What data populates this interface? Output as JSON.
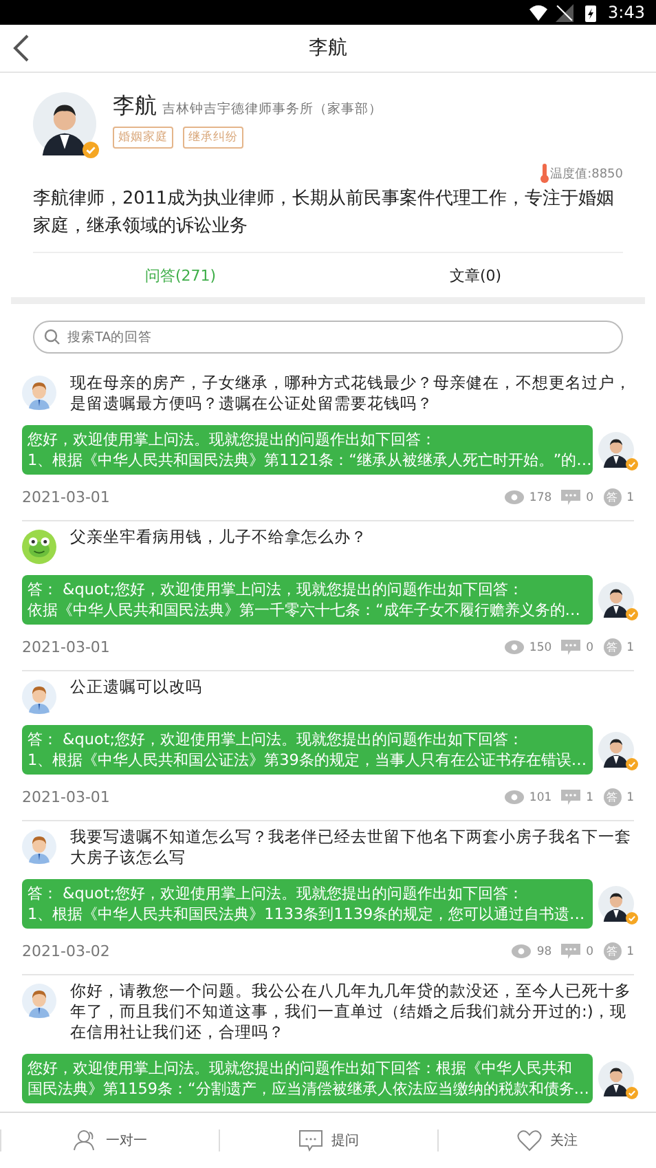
{
  "status_bar": {
    "time": "3:43"
  },
  "header": {
    "title": "李航"
  },
  "profile": {
    "name": "李航",
    "firm": "吉林钟吉宇德律师事务所（家事部）",
    "tags": [
      "婚姻家庭",
      "继承纠纷"
    ],
    "temperature": "温度值:8850",
    "bio": "李航律师，2011成为执业律师，长期从前民事案件代理工作，专注于婚姻家庭，继承领域的诉讼业务"
  },
  "tabs": [
    {
      "label": "问答(271)",
      "selected": true
    },
    {
      "label": "文章(0)",
      "selected": false
    }
  ],
  "search": {
    "placeholder": "搜索TA的回答"
  },
  "questions": [
    {
      "kind": "person",
      "question": "现在母亲的房产，子女继承，哪种方式花钱最少？母亲健在，不想更名过户，是留遗嘱最方便吗？遗嘱在公证处留需要花钱吗？",
      "answer": [
        "您好，欢迎使用掌上问法。现就您提出的问题作出如下回答：",
        "1、根据《中华人民共和国民法典》第1121条：“继承从被继承人死亡时开始。”的…"
      ],
      "date": "2021-03-01",
      "views": "178",
      "comments": "0",
      "badge": "答",
      "answers": "1"
    },
    {
      "kind": "frog",
      "question": "父亲坐牢看病用钱，儿子不给拿怎么办？",
      "answer": [
        "答： &quot;您好，欢迎使用掌上问法，现就您提出的问题作出如下回答：",
        "依据《中华人民共和国民法典》第一千零六十七条：“成年子女不履行赡养义务的…"
      ],
      "date": "2021-03-01",
      "views": "150",
      "comments": "0",
      "badge": "答",
      "answers": "1"
    },
    {
      "kind": "person",
      "question": "公正遗嘱可以改吗",
      "answer": [
        "答： &quot;您好，欢迎使用掌上问法。现就您提出的问题作出如下回答：",
        "1、根据《中华人民共和国公证法》第39条的规定，当事人只有在公证书存在错误…"
      ],
      "date": "2021-03-01",
      "views": "101",
      "comments": "1",
      "badge": "答",
      "answers": "1"
    },
    {
      "kind": "person",
      "question": "我要写遗嘱不知道怎么写？我老伴已经去世留下他名下两套小房子我名下一套大房子该怎么写",
      "answer": [
        "答： &quot;您好，欢迎使用掌上问法。现就您提出的问题作出如下回答：",
        "1、根据《中华人民共和国民法典》1133条到1139条的规定，您可以通过自书遗…"
      ],
      "date": "2021-03-02",
      "views": "98",
      "comments": "0",
      "badge": "答",
      "answers": "1"
    },
    {
      "kind": "person",
      "question": "你好，请教您一个问题。我公公在八几年九几年贷的款没还，至今人已死十多年了，而且我们不知道这事，我们一直单过（结婚之后我们就分开过的:)，现在信用社让我们还，合理吗？",
      "answer": [
        "您好，欢迎使用掌上问法。现就您提出的问题作出如下回答：根据《中华人民共和",
        "国民法典》第1159条：“分割遗产，应当清偿被继承人依法应当缴纳的税款和债务…"
      ]
    }
  ],
  "bottom_bar": [
    {
      "kind": "person",
      "label": "一对一"
    },
    {
      "kind": "chat",
      "label": "提问"
    },
    {
      "kind": "heart",
      "label": "关注"
    }
  ]
}
